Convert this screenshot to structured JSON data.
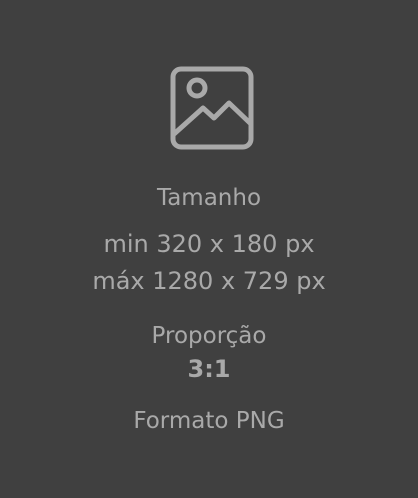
{
  "upload_placeholder": {
    "icon": "image-placeholder-icon",
    "size_label": "Tamanho",
    "size_min": "min 320 x 180 px",
    "size_max": "máx 1280 x 729 px",
    "ratio_label": "Proporção",
    "ratio_value": "3:1",
    "format_text": "Formato PNG"
  }
}
